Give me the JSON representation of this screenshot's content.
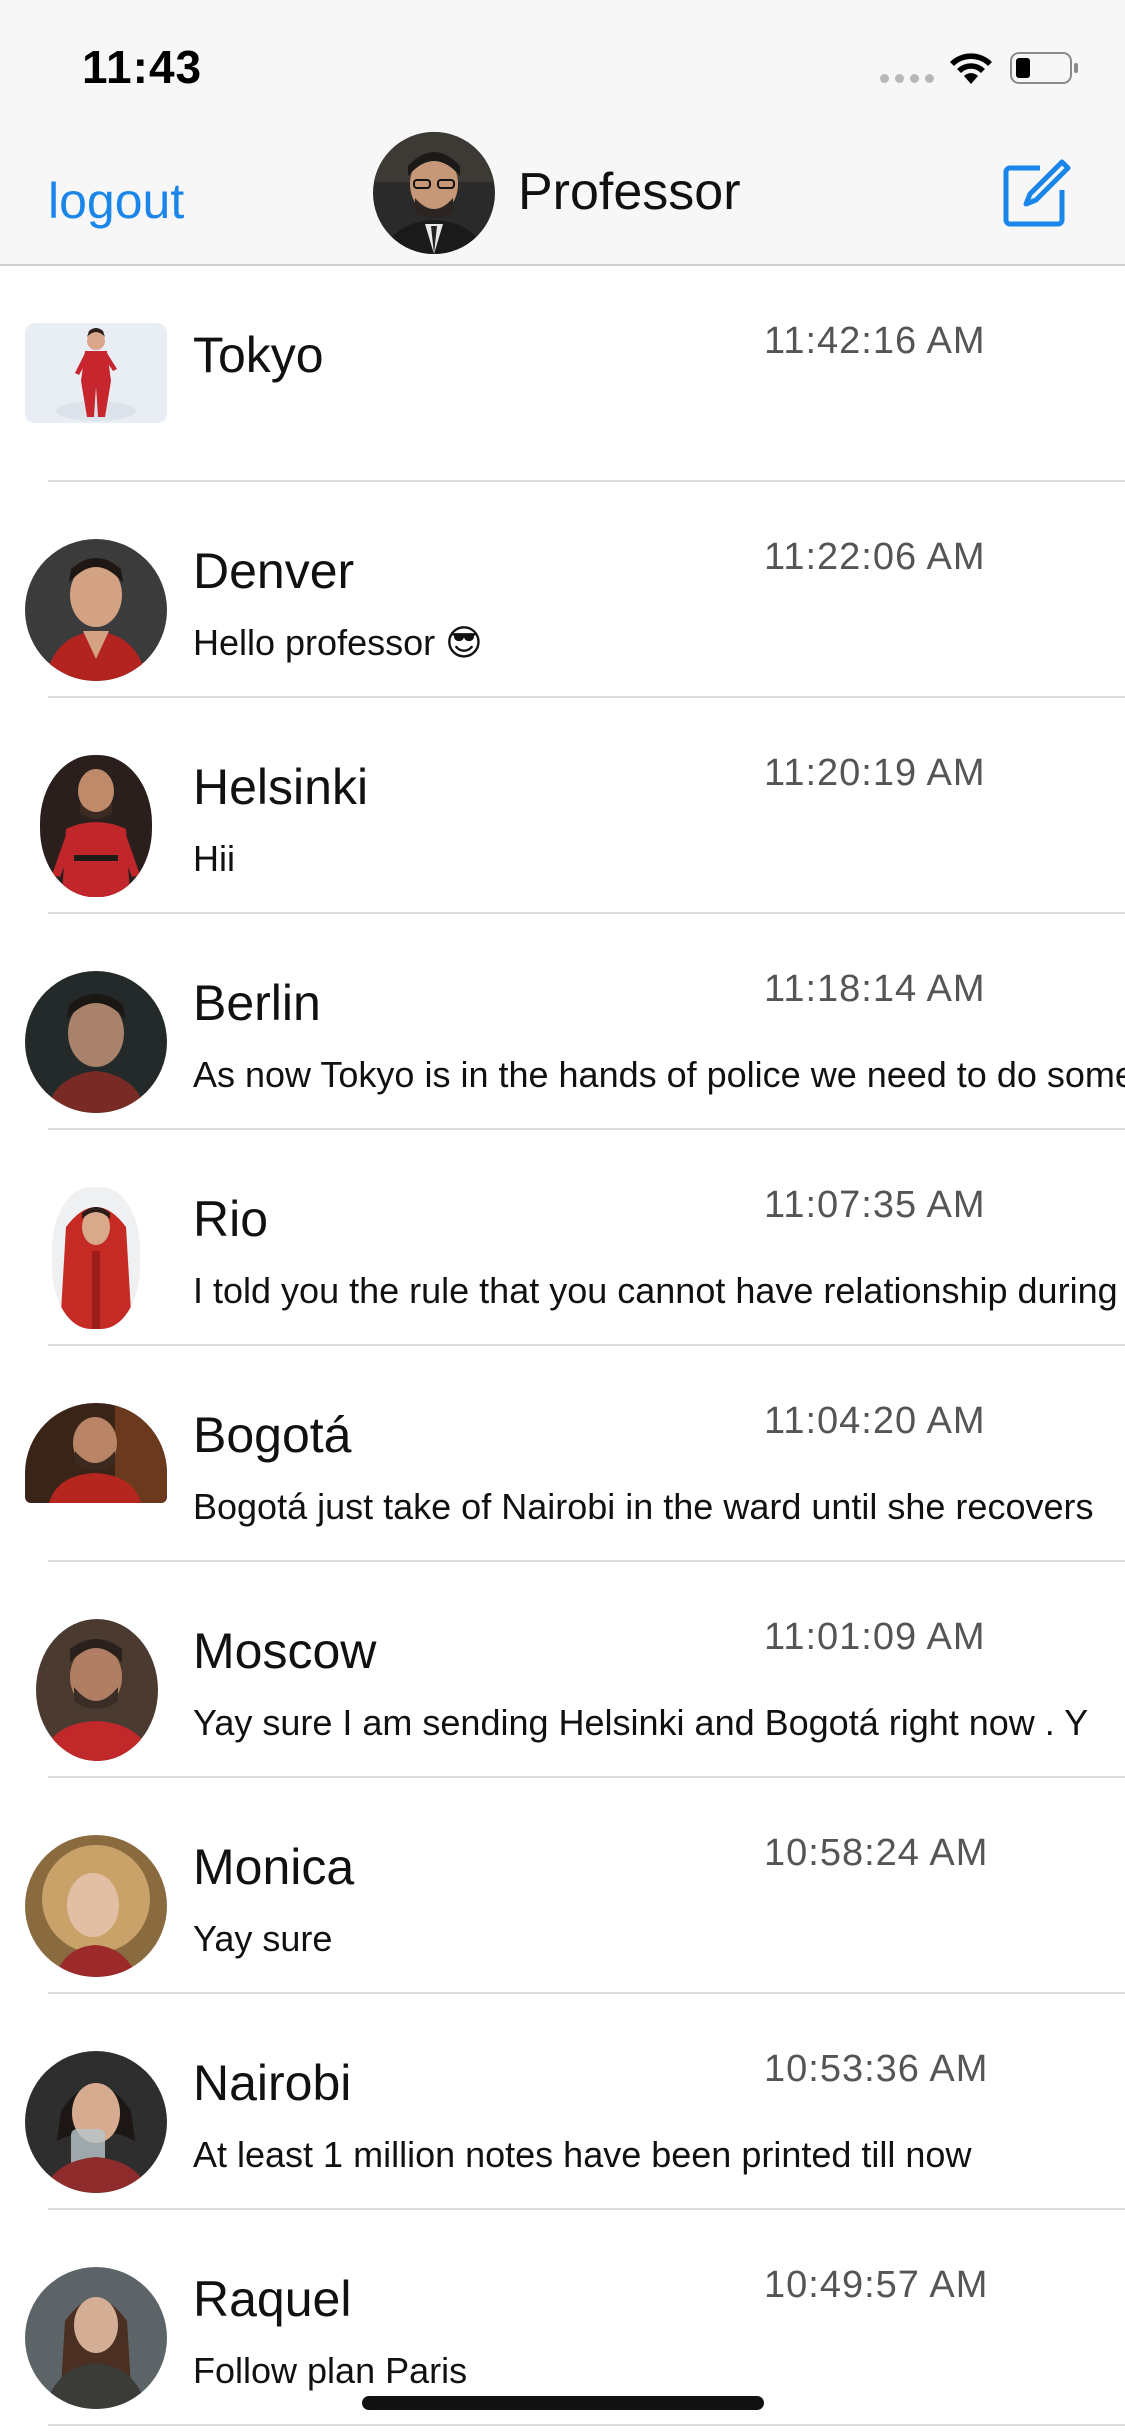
{
  "status_bar": {
    "time": "11:43",
    "icons": [
      "signal-dots-icon",
      "wifi-icon",
      "battery-icon"
    ]
  },
  "nav": {
    "logout_label": "logout",
    "title": "Professor",
    "compose_icon": "compose-icon",
    "accent_color": "#1a86ea"
  },
  "chats": [
    {
      "name": "Tokyo",
      "time": "11:42:16 AM",
      "message": "",
      "avatar_color": "#c8262e",
      "avatar_bg": "#e9eef4"
    },
    {
      "name": "Denver",
      "time": "11:22:06 AM",
      "message": "Hello professor 😎",
      "avatar_color": "#b3231f",
      "avatar_bg": "#3b3b3b"
    },
    {
      "name": "Helsinki",
      "time": "11:20:19 AM",
      "message": "Hii",
      "avatar_color": "#c1262a",
      "avatar_bg": "#2a1f1d"
    },
    {
      "name": "Berlin",
      "time": "11:18:14 AM",
      "message": "As now Tokyo is in the hands of police we need to do something",
      "avatar_color": "#7a2a24",
      "avatar_bg": "#242a2a"
    },
    {
      "name": "Rio",
      "time": "11:07:35 AM",
      "message": "I told you the rule that you cannot have relationship during the heist",
      "avatar_color": "#c62a25",
      "avatar_bg": "#eef0f2"
    },
    {
      "name": "Bogotá",
      "time": "11:04:20 AM",
      "message": "Bogotá just take of Nairobi in the ward until she recovers",
      "avatar_color": "#b5261f",
      "avatar_bg": "#3a2418"
    },
    {
      "name": "Moscow",
      "time": "11:01:09 AM",
      "message": "Yay sure I am sending Helsinki and Bogotá right now . Y",
      "avatar_color": "#c0282a",
      "avatar_bg": "#4b3a30"
    },
    {
      "name": "Monica",
      "time": "10:58:24 AM",
      "message": "Yay sure",
      "avatar_color": "#c9a26a",
      "avatar_bg": "#8a6a3f"
    },
    {
      "name": "Nairobi",
      "time": "10:53:36 AM",
      "message": "At least 1 million notes have been printed till now",
      "avatar_color": "#8e2b2b",
      "avatar_bg": "#2e2e2e"
    },
    {
      "name": "Raquel",
      "time": "10:49:57 AM",
      "message": "Follow plan Paris",
      "avatar_color": "#3b3b38",
      "avatar_bg": "#5d6468"
    }
  ]
}
